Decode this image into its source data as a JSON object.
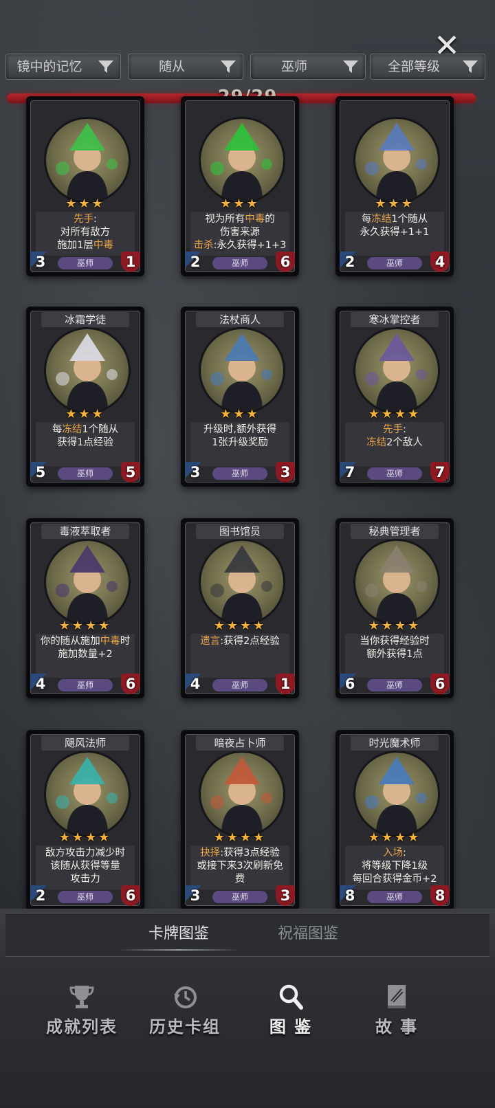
{
  "header": {
    "close_label": "✕",
    "filters": [
      {
        "label": "镜中的记忆"
      },
      {
        "label": "随从"
      },
      {
        "label": "巫师"
      },
      {
        "label": "全部等级"
      }
    ],
    "count": "29/29"
  },
  "cards": [
    {
      "name": "",
      "stars": "★★★",
      "desc": [
        {
          "t": "先手",
          "c": "hl"
        },
        {
          "t": ":\n对所有敌方\n施加1层"
        },
        {
          "t": "中毒",
          "c": "hl"
        }
      ],
      "atk": "3",
      "hp": "1",
      "class": "巫师",
      "art": "#3fbf4a"
    },
    {
      "name": "",
      "stars": "★★★",
      "desc": [
        {
          "t": "视为所有"
        },
        {
          "t": "中毒",
          "c": "hl"
        },
        {
          "t": "的\n伤害来源\n"
        },
        {
          "t": "击杀",
          "c": "hl"
        },
        {
          "t": ":永久获得+1+3"
        }
      ],
      "atk": "2",
      "hp": "6",
      "class": "巫师",
      "art": "#2fbf3a"
    },
    {
      "name": "",
      "stars": "★★★",
      "desc": [
        {
          "t": "每"
        },
        {
          "t": "冻结",
          "c": "hl"
        },
        {
          "t": "1个随从\n永久获得+1+1"
        }
      ],
      "atk": "2",
      "hp": "4",
      "class": "巫师",
      "art": "#5a7ab8"
    },
    {
      "name": "冰霜学徒",
      "stars": "★★★",
      "desc": [
        {
          "t": "每"
        },
        {
          "t": "冻结",
          "c": "hl"
        },
        {
          "t": "1个随从\n获得1点经验"
        }
      ],
      "atk": "5",
      "hp": "5",
      "class": "巫师",
      "art": "#d8d8e0"
    },
    {
      "name": "法杖商人",
      "stars": "★★★",
      "desc": [
        {
          "t": "升级时,额外获得\n1张升级奖励"
        }
      ],
      "atk": "3",
      "hp": "3",
      "class": "巫师",
      "art": "#4a7ab0"
    },
    {
      "name": "寒冰掌控者",
      "stars": "★★★★",
      "desc": [
        {
          "t": "先手",
          "c": "hl"
        },
        {
          "t": ":\n"
        },
        {
          "t": "冻结",
          "c": "hl"
        },
        {
          "t": "2个敌人"
        }
      ],
      "atk": "7",
      "hp": "7",
      "class": "巫师",
      "art": "#6a5a9a"
    },
    {
      "name": "毒液萃取者",
      "stars": "★★★★",
      "desc": [
        {
          "t": "你的随从施加"
        },
        {
          "t": "中毒",
          "c": "hl"
        },
        {
          "t": "时\n施加数量+2"
        }
      ],
      "atk": "4",
      "hp": "6",
      "class": "巫师",
      "art": "#4a3a6a"
    },
    {
      "name": "图书馆员",
      "stars": "★★★★",
      "desc": [
        {
          "t": "遗言",
          "c": "hl"
        },
        {
          "t": ":获得2点经验"
        }
      ],
      "atk": "4",
      "hp": "1",
      "class": "巫师",
      "art": "#3a3a3e"
    },
    {
      "name": "秘典管理者",
      "stars": "★★★★",
      "desc": [
        {
          "t": "当你获得经验时\n额外获得1点"
        }
      ],
      "atk": "6",
      "hp": "6",
      "class": "巫师",
      "art": "#8a8070"
    },
    {
      "name": "飓风法师",
      "stars": "★★★★",
      "desc": [
        {
          "t": "敌方攻击力减少时\n该随从获得等量\n攻击力"
        }
      ],
      "atk": "2",
      "hp": "6",
      "class": "巫师",
      "art": "#3ab0a8"
    },
    {
      "name": "暗夜占卜师",
      "stars": "★★★★",
      "desc": [
        {
          "t": "抉择",
          "c": "hl"
        },
        {
          "t": ":获得3点经验\n或接下来3次刷新免\n费"
        }
      ],
      "atk": "3",
      "hp": "3",
      "class": "巫师",
      "art": "#c05a3a"
    },
    {
      "name": "时光魔术师",
      "stars": "★★★★",
      "desc": [
        {
          "t": "入场",
          "c": "hl"
        },
        {
          "t": ":\n将等级下降1级\n每回合获得金币+2"
        }
      ],
      "atk": "8",
      "hp": "8",
      "class": "巫师",
      "art": "#4a7ab8"
    }
  ],
  "subtabs": [
    {
      "label": "卡牌图鉴"
    },
    {
      "label": "祝福图鉴"
    }
  ],
  "nav": [
    {
      "label": "成就列表",
      "icon": "trophy-icon"
    },
    {
      "label": "历史卡组",
      "icon": "history-icon"
    },
    {
      "label": "图 鉴",
      "icon": "magnifier-icon"
    },
    {
      "label": "故 事",
      "icon": "book-icon"
    }
  ],
  "colors": {
    "accent_text": "#e8a548",
    "star": "#f2b13a",
    "hp_red": "#8d1a22",
    "class_purple": "#5b4a80",
    "bar_red": "#b8262e"
  }
}
